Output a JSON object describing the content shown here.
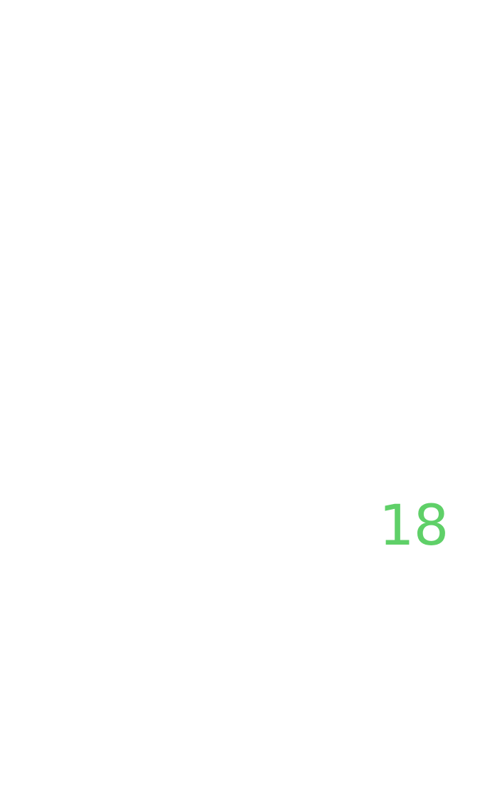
{
  "display": {
    "value": "18",
    "color": "#5fd068"
  }
}
